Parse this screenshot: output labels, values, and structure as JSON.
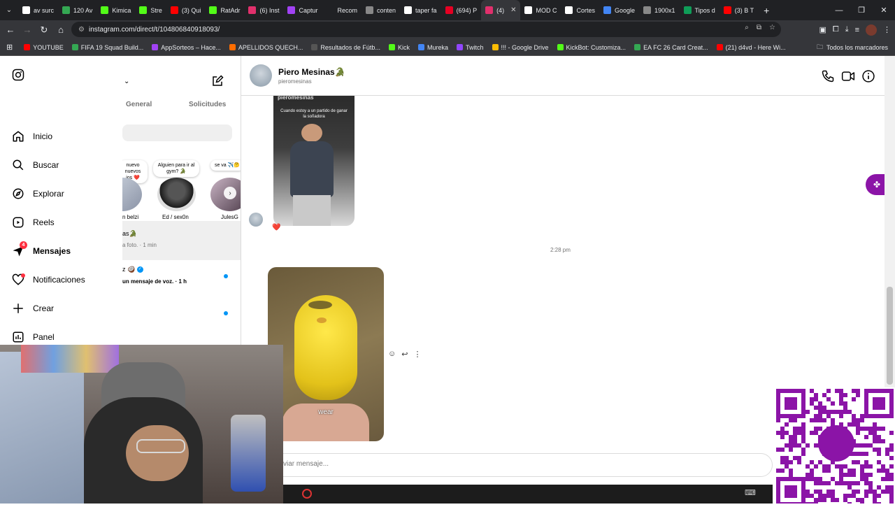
{
  "browser": {
    "tabs": [
      {
        "label": "av surc",
        "color": "#ffffff"
      },
      {
        "label": "120 Av",
        "color": "#34a853"
      },
      {
        "label": "Kimica",
        "color": "#53fc18"
      },
      {
        "label": "Stre",
        "color": "#53fc18"
      },
      {
        "label": "(3) Qui",
        "color": "#ff0000"
      },
      {
        "label": "RatAdr",
        "color": "#53fc18"
      },
      {
        "label": "(6) Inst",
        "color": "#e1306c"
      },
      {
        "label": "Captur",
        "color": "#a142f4"
      },
      {
        "label": "Recom",
        "color": "#202124"
      },
      {
        "label": "conten",
        "color": "#888888"
      },
      {
        "label": "taper fa",
        "color": "#ffffff"
      },
      {
        "label": "(694) P",
        "color": "#e60023"
      },
      {
        "label": "(4)",
        "color": "#e1306c",
        "active": true
      },
      {
        "label": "MOD C",
        "color": "#ffffff"
      },
      {
        "label": "Cortes",
        "color": "#ffffff"
      },
      {
        "label": "Google",
        "color": "#4285f4"
      },
      {
        "label": "1900x1",
        "color": "#888888"
      },
      {
        "label": "Tipos d",
        "color": "#0f9d58"
      },
      {
        "label": "(3) B T",
        "color": "#ff0000"
      }
    ],
    "url": "instagram.com/direct/t/104806840918093/",
    "bookmarks": [
      {
        "label": "YOUTUBE",
        "color": "#ff0000"
      },
      {
        "label": "FIFA 19 Squad Build...",
        "color": "#34a853"
      },
      {
        "label": "AppSorteos – Hace...",
        "color": "#a142f4"
      },
      {
        "label": "APELLIDOS QUECH...",
        "color": "#ff6d00"
      },
      {
        "label": "Resultados de Fútb...",
        "color": "#555555"
      },
      {
        "label": "Kick",
        "color": "#53fc18"
      },
      {
        "label": "Mureka",
        "color": "#4285f4"
      },
      {
        "label": "Twitch",
        "color": "#9146ff"
      },
      {
        "label": "!!! - Google Drive",
        "color": "#fbbc04"
      },
      {
        "label": "KickBot: Customiza...",
        "color": "#53fc18"
      },
      {
        "label": "EA FC 26 Card Creat...",
        "color": "#34a853"
      },
      {
        "label": "(21) d4vd - Here Wi...",
        "color": "#ff0000"
      }
    ],
    "all_bookmarks": "Todos los marcadores"
  },
  "sidebar": {
    "items": [
      {
        "label": "Inicio",
        "icon": "home-icon"
      },
      {
        "label": "Buscar",
        "icon": "search-icon"
      },
      {
        "label": "Explorar",
        "icon": "explore-icon"
      },
      {
        "label": "Reels",
        "icon": "reels-icon"
      },
      {
        "label": "Mensajes",
        "icon": "messages-icon",
        "badge": "4"
      },
      {
        "label": "Notificaciones",
        "icon": "heart-icon"
      },
      {
        "label": "Crear",
        "icon": "plus-icon"
      },
      {
        "label": "Panel",
        "icon": "panel-icon"
      }
    ]
  },
  "inbox": {
    "tabs": [
      "General",
      "Solicitudes"
    ],
    "notes": [
      "nuevo nuevos ios ❤️",
      "Alguien para ir al gym? 🐊",
      "se va ✈️🤔"
    ],
    "stories": [
      "n belzi",
      "Ed / sex0n",
      "JulesG"
    ],
    "threads": [
      {
        "name": "as🐊",
        "preview": "a foto. · 1 min"
      },
      {
        "name": "z 🥥",
        "preview": "un mensaje de voz. · 1 h"
      }
    ]
  },
  "chat": {
    "name": "Piero Mesinas🐊",
    "username": "pieromesinas",
    "timestamp": "2:28 pm",
    "media1": {
      "overlay_handle": "pieromesinas",
      "caption": "Cuando estoy a un partido de ganar la soñadora"
    },
    "media2": {
      "caption": "wear"
    },
    "reaction": "❤️",
    "input_placeholder": "viar mensaje..."
  },
  "colors": {
    "brand_purple": "#8b14a7",
    "unread_dot": "#0095f6",
    "badge_red": "#ff3040"
  }
}
